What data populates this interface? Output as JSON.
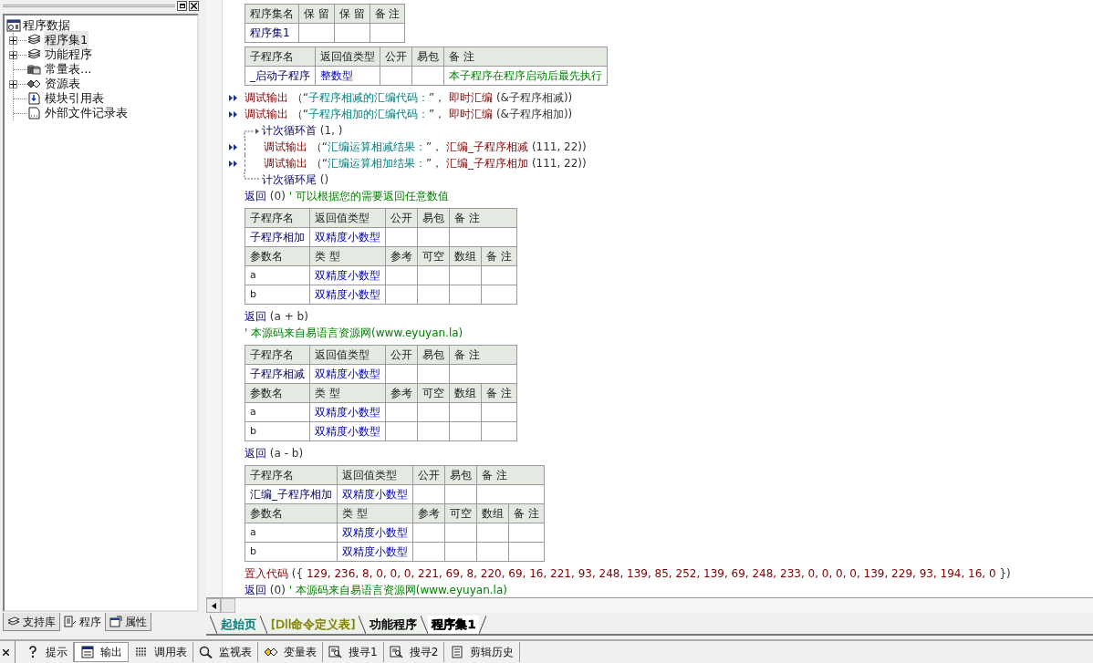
{
  "left_panel": {
    "tree": {
      "label": "程序数据",
      "kind": "root",
      "children": [
        {
          "label": "程序集1",
          "kind": "set",
          "expanded": false,
          "selected": true
        },
        {
          "label": "功能程序",
          "kind": "set",
          "expanded": false,
          "selected": false
        },
        {
          "label": "常量表...",
          "kind": "constant",
          "selected": false
        },
        {
          "label": "资源表",
          "kind": "resource",
          "expanded": false,
          "selected": false
        },
        {
          "label": "模块引用表",
          "kind": "module",
          "selected": false
        },
        {
          "label": "外部文件记录表",
          "kind": "file",
          "selected": false
        }
      ]
    },
    "tabs": [
      {
        "label": "支持库",
        "kind": "library",
        "selected": false
      },
      {
        "label": "程序",
        "kind": "program",
        "selected": true
      },
      {
        "label": "属性",
        "kind": "properties",
        "selected": false
      }
    ]
  },
  "document": [
    {
      "kind": "table",
      "columns": [
        "程序集名",
        "保 留",
        "保 留",
        "备 注"
      ],
      "rows": [
        {
          "name": "程序集1"
        }
      ]
    },
    {
      "kind": "table",
      "columns": [
        "子程序名",
        "返回值类型",
        "公开",
        "易包",
        "备 注"
      ],
      "rows": [
        {
          "name": "_启动子程序",
          "type": "整数型",
          "remark": "本子程序在程序启动后最先执行"
        }
      ]
    },
    {
      "kind": "line",
      "marked": true,
      "segments": [
        {
          "kind": "cmd",
          "text": "调试输出"
        },
        {
          "kind": "text",
          "text": " （“"
        },
        {
          "kind": "str",
          "text": "子程序相减的汇编代码："
        },
        {
          "kind": "text",
          "text": "”， "
        },
        {
          "kind": "cmd",
          "text": "即时汇编"
        },
        {
          "kind": "text",
          "text": " (&子程序相减))"
        }
      ]
    },
    {
      "kind": "line",
      "marked": true,
      "segments": [
        {
          "kind": "cmd",
          "text": "调试输出"
        },
        {
          "kind": "text",
          "text": " （“"
        },
        {
          "kind": "str",
          "text": "子程序相加的汇编代码："
        },
        {
          "kind": "text",
          "text": "”， "
        },
        {
          "kind": "cmd",
          "text": "即时汇编"
        },
        {
          "kind": "text",
          "text": " (&子程序相加))"
        }
      ]
    },
    {
      "kind": "loop",
      "head": [
        {
          "kind": "flow",
          "text": "计次循环首"
        },
        {
          "kind": "text",
          "text": " (1, )"
        }
      ],
      "children": [
        {
          "kind": "line",
          "marked": true,
          "segments": [
            {
              "kind": "cmd",
              "text": "调试输出"
            },
            {
              "kind": "text",
              "text": " （“"
            },
            {
              "kind": "str",
              "text": "汇编运算相减结果："
            },
            {
              "kind": "text",
              "text": "”， "
            },
            {
              "kind": "cmd",
              "text": "汇编_子程序相减"
            },
            {
              "kind": "text",
              "text": " (111, 22))"
            }
          ]
        },
        {
          "kind": "line",
          "marked": true,
          "segments": [
            {
              "kind": "cmd",
              "text": "调试输出"
            },
            {
              "kind": "text",
              "text": " （“"
            },
            {
              "kind": "str",
              "text": "汇编运算相加结果："
            },
            {
              "kind": "text",
              "text": "”， "
            },
            {
              "kind": "cmd",
              "text": "汇编_子程序相加"
            },
            {
              "kind": "text",
              "text": " (111, 22))"
            }
          ]
        }
      ],
      "tail": [
        {
          "kind": "flow",
          "text": "计次循环尾"
        },
        {
          "kind": "text",
          "text": " ()"
        }
      ]
    },
    {
      "kind": "line",
      "marked": false,
      "segments": [
        {
          "kind": "flow",
          "text": "返回"
        },
        {
          "kind": "text",
          "text": " (0) "
        },
        {
          "kind": "comment",
          "text": "' 可以根据您的需要返回任意数值"
        }
      ]
    },
    {
      "kind": "subprogram",
      "columns": [
        "子程序名",
        "返回值类型",
        "公开",
        "易包",
        "备 注"
      ],
      "rows": [
        {
          "name": "子程序相加",
          "type": "双精度小数型"
        }
      ],
      "params": {
        "columns": [
          "参数名",
          "类 型",
          "参考",
          "可空",
          "数组",
          "备 注"
        ],
        "rows": [
          {
            "name": "a",
            "type": "双精度小数型"
          },
          {
            "name": "b",
            "type": "双精度小数型"
          }
        ]
      }
    },
    {
      "kind": "line",
      "marked": false,
      "segments": [
        {
          "kind": "flow",
          "text": "返回"
        },
        {
          "kind": "text",
          "text": " (a + b)"
        }
      ]
    },
    {
      "kind": "line",
      "marked": false,
      "segments": [
        {
          "kind": "comment",
          "text": "' 本源码来自易语言资源网(www.eyuyan.la)"
        }
      ]
    },
    {
      "kind": "subprogram",
      "columns": [
        "子程序名",
        "返回值类型",
        "公开",
        "易包",
        "备 注"
      ],
      "rows": [
        {
          "name": "子程序相减",
          "type": "双精度小数型"
        }
      ],
      "params": {
        "columns": [
          "参数名",
          "类 型",
          "参考",
          "可空",
          "数组",
          "备 注"
        ],
        "rows": [
          {
            "name": "a",
            "type": "双精度小数型"
          },
          {
            "name": "b",
            "type": "双精度小数型"
          }
        ]
      }
    },
    {
      "kind": "line",
      "marked": false,
      "segments": [
        {
          "kind": "flow",
          "text": "返回"
        },
        {
          "kind": "text",
          "text": " (a - b)"
        }
      ]
    },
    {
      "kind": "subprogram",
      "columns": [
        "子程序名",
        "返回值类型",
        "公开",
        "易包",
        "备 注"
      ],
      "rows": [
        {
          "name": "汇编_子程序相加",
          "type": "双精度小数型"
        }
      ],
      "params": {
        "columns": [
          "参数名",
          "类 型",
          "参考",
          "可空",
          "数组",
          "备 注"
        ],
        "rows": [
          {
            "name": "a",
            "type": "双精度小数型"
          },
          {
            "name": "b",
            "type": "双精度小数型"
          }
        ]
      }
    },
    {
      "kind": "line",
      "marked": false,
      "segments": [
        {
          "kind": "cmd",
          "text": "置入代码"
        },
        {
          "kind": "text",
          "text": " ({ "
        },
        {
          "kind": "num",
          "text": "129, 236, 8, 0, 0, 0, 221, 69, 8, 220, 69, 16, 221, 93, 248, 139, 85, 252, 139, 69, 248, 233, 0, 0, 0, 0, 139, 229, 93, 194, 16, 0"
        },
        {
          "kind": "text",
          "text": " })"
        }
      ]
    },
    {
      "kind": "line",
      "marked": false,
      "segments": [
        {
          "kind": "flow",
          "text": "返回"
        },
        {
          "kind": "text",
          "text": " (0) "
        },
        {
          "kind": "comment",
          "text": "' 本源码来自易语言资源网(www.eyuyan.la)"
        }
      ]
    }
  ],
  "editor_tabs": [
    {
      "label": "起始页",
      "color": "#008080",
      "selected": false
    },
    {
      "label": "[Dll命令定义表]",
      "color": "#808000",
      "selected": false
    },
    {
      "label": "功能程序",
      "color": "#000000",
      "selected": false
    },
    {
      "label": "程序集1",
      "color": "#000000",
      "selected": true
    }
  ],
  "toolbar": [
    {
      "label": "提示",
      "kind": "hint",
      "selected": false
    },
    {
      "label": "输出",
      "kind": "output",
      "selected": true
    },
    {
      "label": "调用表",
      "kind": "calls",
      "selected": false
    },
    {
      "label": "监视表",
      "kind": "watch",
      "selected": false
    },
    {
      "label": "变量表",
      "kind": "variables",
      "selected": false
    },
    {
      "label": "搜寻1",
      "kind": "search",
      "selected": false
    },
    {
      "label": "搜寻2",
      "kind": "search",
      "selected": false
    },
    {
      "label": "剪辑历史",
      "kind": "clipboard",
      "selected": false
    }
  ]
}
